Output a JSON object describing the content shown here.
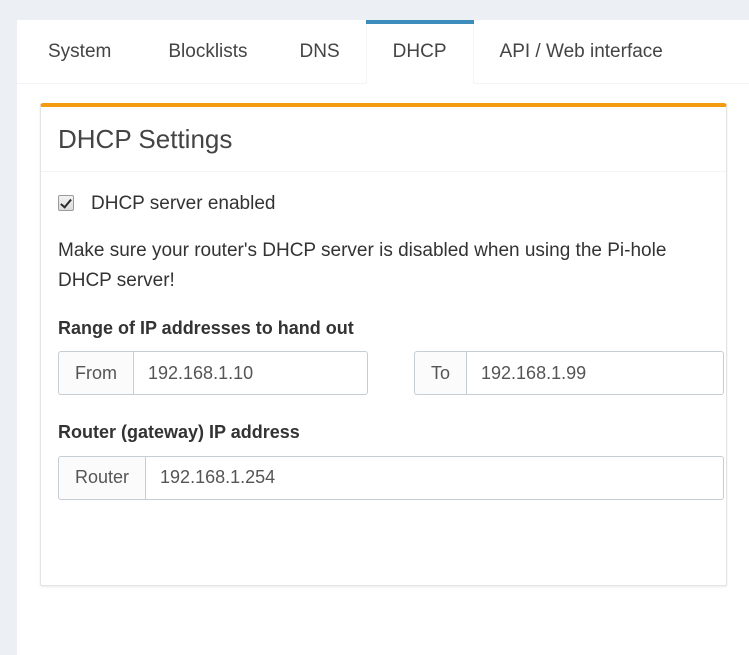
{
  "theme": {
    "accent_blue": "#3c8dbc",
    "accent_orange": "#f39c12",
    "page_bg": "#ecf0f5",
    "card_bg": "#ffffff",
    "text": "#333333"
  },
  "tabs": [
    {
      "label": "System",
      "active": false
    },
    {
      "label": "Blocklists",
      "active": false
    },
    {
      "label": "DNS",
      "active": false
    },
    {
      "label": "DHCP",
      "active": true
    },
    {
      "label": "API / Web interface",
      "active": false
    }
  ],
  "card": {
    "title": "DHCP Settings",
    "checkbox": {
      "label": "DHCP server enabled",
      "checked": true
    },
    "notice": "Make sure your router's DHCP server is disabled when using the Pi-hole DHCP server!",
    "range_section": {
      "title": "Range of IP addresses to hand out",
      "from": {
        "addon_label": "From",
        "value": "192.168.1.10",
        "placeholder": "192.168.1.10"
      },
      "to": {
        "addon_label": "To",
        "value": "192.168.1.99",
        "placeholder": "192.168.1.99"
      }
    },
    "router_section": {
      "title": "Router (gateway) IP address",
      "router": {
        "addon_label": "Router",
        "value": "192.168.1.254",
        "placeholder": "192.168.1.254"
      }
    }
  }
}
